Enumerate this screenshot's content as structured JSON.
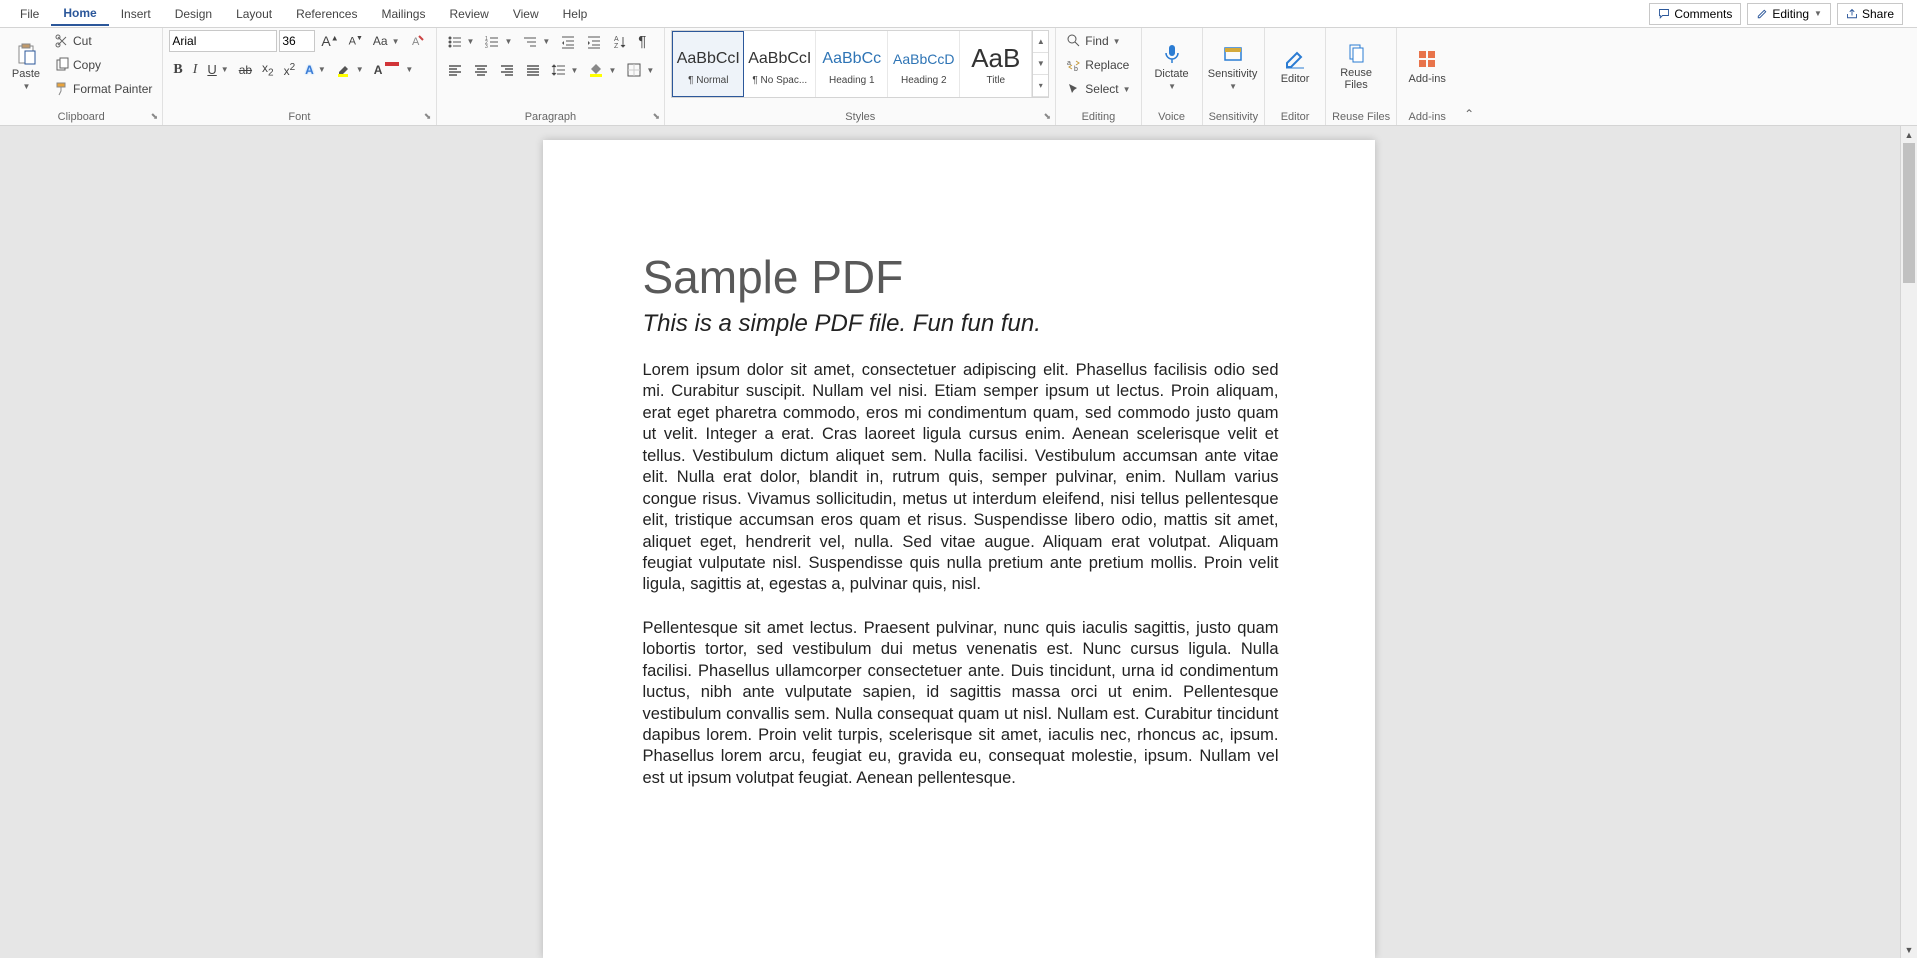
{
  "tabs": [
    "File",
    "Home",
    "Insert",
    "Design",
    "Layout",
    "References",
    "Mailings",
    "Review",
    "View",
    "Help"
  ],
  "active_tab": "Home",
  "top_buttons": {
    "comments": "Comments",
    "editing": "Editing",
    "share": "Share"
  },
  "clipboard": {
    "paste": "Paste",
    "cut": "Cut",
    "copy": "Copy",
    "format_painter": "Format Painter",
    "label": "Clipboard"
  },
  "font": {
    "name": "Arial",
    "size": "36",
    "label": "Font"
  },
  "paragraph": {
    "label": "Paragraph"
  },
  "styles": {
    "label": "Styles",
    "items": [
      {
        "preview": "AaBbCcI",
        "name": "¶ Normal",
        "selected": true
      },
      {
        "preview": "AaBbCcI",
        "name": "¶ No Spac..."
      },
      {
        "preview": "AaBbCc",
        "name": "Heading 1",
        "color": "#2e74b5"
      },
      {
        "preview": "AaBbCcD",
        "name": "Heading 2",
        "color": "#2e74b5"
      },
      {
        "preview": "AaB",
        "name": "Title",
        "big": true
      }
    ]
  },
  "editing": {
    "find": "Find",
    "replace": "Replace",
    "select": "Select",
    "label": "Editing"
  },
  "voice": {
    "dictate": "Dictate",
    "label": "Voice"
  },
  "sensitivity": {
    "btn": "Sensitivity",
    "label": "Sensitivity"
  },
  "editor": {
    "btn": "Editor",
    "label": "Editor"
  },
  "reuse": {
    "btn": "Reuse\nFiles",
    "label": "Reuse Files"
  },
  "addins": {
    "btn": "Add-ins",
    "label": "Add-ins"
  },
  "document": {
    "title": "Sample PDF",
    "subtitle": "This is a simple PDF file. Fun fun fun.",
    "para1": "Lorem ipsum dolor sit amet, consectetuer adipiscing elit. Phasellus facilisis odio sed mi. Curabitur suscipit. Nullam vel nisi. Etiam semper ipsum ut lectus. Proin aliquam, erat eget pharetra commodo, eros mi condimentum quam, sed commodo justo quam ut velit. Integer a erat. Cras laoreet ligula cursus enim. Aenean scelerisque velit et tellus. Vestibulum dictum aliquet sem. Nulla facilisi. Vestibulum accumsan ante vitae elit. Nulla erat dolor, blandit in, rutrum quis, semper pulvinar, enim. Nullam varius congue risus. Vivamus sollicitudin, metus ut interdum eleifend, nisi tellus pellentesque elit, tristique accumsan eros quam et risus. Suspendisse libero odio, mattis sit amet, aliquet eget, hendrerit vel, nulla. Sed vitae augue. Aliquam erat volutpat. Aliquam feugiat vulputate nisl. Suspendisse quis nulla pretium ante pretium mollis. Proin velit ligula, sagittis at, egestas a, pulvinar quis, nisl.",
    "para2": "Pellentesque sit amet lectus. Praesent pulvinar, nunc quis iaculis sagittis, justo quam lobortis tortor, sed vestibulum dui metus venenatis est. Nunc cursus ligula. Nulla facilisi. Phasellus ullamcorper consectetuer ante. Duis tincidunt, urna id condimentum luctus, nibh ante vulputate sapien, id sagittis massa orci ut enim. Pellentesque vestibulum convallis sem. Nulla consequat quam ut nisl. Nullam est. Curabitur tincidunt dapibus lorem. Proin velit turpis, scelerisque sit amet, iaculis nec, rhoncus ac, ipsum. Phasellus lorem arcu, feugiat eu, gravida eu, consequat molestie, ipsum. Nullam vel est ut ipsum volutpat feugiat. Aenean pellentesque."
  }
}
